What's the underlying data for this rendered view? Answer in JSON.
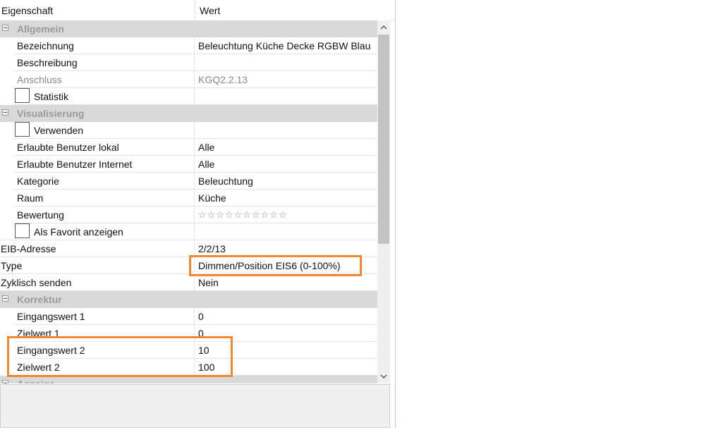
{
  "header": {
    "col_property": "Eigenschaft",
    "col_value": "Wert"
  },
  "categories": {
    "allgemein": "Allgemein",
    "visualisierung": "Visualisierung",
    "korrektur": "Korrektur",
    "anzeige": "Anzeige"
  },
  "rows": {
    "bezeichnung": {
      "label": "Bezeichnung",
      "value": "Beleuchtung Küche Decke RGBW Blau"
    },
    "beschreibung": {
      "label": "Beschreibung",
      "value": ""
    },
    "anschluss": {
      "label": "Anschluss",
      "value": "KGQ2.2.13"
    },
    "statistik": {
      "label": "Statistik",
      "checked": false
    },
    "verwenden": {
      "label": "Verwenden",
      "checked": false
    },
    "benutzer_lokal": {
      "label": "Erlaubte Benutzer lokal",
      "value": "Alle"
    },
    "benutzer_internet": {
      "label": "Erlaubte Benutzer Internet",
      "value": "Alle"
    },
    "kategorie": {
      "label": "Kategorie",
      "value": "Beleuchtung"
    },
    "raum": {
      "label": "Raum",
      "value": "Küche"
    },
    "bewertung": {
      "label": "Bewertung",
      "stars": "☆☆☆☆☆☆☆☆☆☆",
      "rating": 0
    },
    "favorit": {
      "label": "Als Favorit anzeigen",
      "checked": false
    },
    "eib_adresse": {
      "label": "EIB-Adresse",
      "value": "2/2/13"
    },
    "type": {
      "label": "Type",
      "value": "Dimmen/Position EIS6 (0-100%)"
    },
    "zyklisch": {
      "label": "Zyklisch senden",
      "value": "Nein"
    },
    "eingangswert1": {
      "label": "Eingangswert 1",
      "value": "0"
    },
    "zielwert1": {
      "label": "Zielwert 1",
      "value": "0"
    },
    "eingangswert2": {
      "label": "Eingangswert 2",
      "value": "10"
    },
    "zielwert2": {
      "label": "Zielwert 2",
      "value": "100"
    }
  },
  "icons": {
    "collapse": "collapse-icon",
    "scroll_up": "chevron-up-icon",
    "scroll_down": "chevron-down-icon",
    "star": "star-icon"
  },
  "colors": {
    "category_bg": "#d9d9d9",
    "category_text": "#9a9a9a",
    "highlight": "#f08a2c",
    "scrollbar_thumb": "#c3c3c3"
  }
}
